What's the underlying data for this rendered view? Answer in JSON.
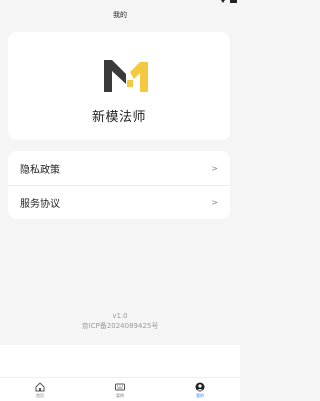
{
  "header": {
    "title": "我的"
  },
  "brand": {
    "app_name": "新模法师"
  },
  "menu": {
    "items": [
      {
        "label": "隐私政策",
        "chevron": ">"
      },
      {
        "label": "服务协议",
        "chevron": ">"
      }
    ]
  },
  "footer": {
    "version": "v1.0",
    "icp": "京ICP备2024089425号"
  },
  "tabs": [
    {
      "label": "首页",
      "icon": "home-icon",
      "active": false
    },
    {
      "label": "案例",
      "icon": "keyboard-icon",
      "active": false
    },
    {
      "label": "我的",
      "icon": "user-icon",
      "active": true
    }
  ],
  "colors": {
    "accent": "#3b7be0",
    "logo_dark": "#3a3a3a",
    "logo_yellow": "#f5c842",
    "background": "#f5f5f5"
  }
}
